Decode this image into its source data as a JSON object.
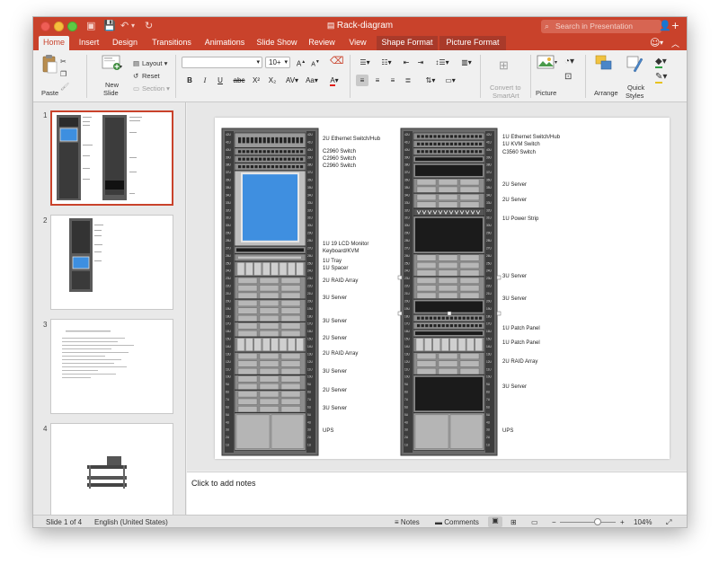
{
  "window": {
    "doc_title": "Rack-diagram",
    "search_placeholder": "Search in Presentation"
  },
  "tabs": [
    {
      "label": "Home",
      "active": true
    },
    {
      "label": "Insert"
    },
    {
      "label": "Design"
    },
    {
      "label": "Transitions"
    },
    {
      "label": "Animations"
    },
    {
      "label": "Slide Show"
    },
    {
      "label": "Review"
    },
    {
      "label": "View"
    },
    {
      "label": "Shape Format",
      "contextual": true
    },
    {
      "label": "Picture Format",
      "contextual": true
    }
  ],
  "ribbon": {
    "paste": "Paste",
    "new_slide_line1": "New",
    "new_slide_line2": "Slide",
    "layout": "Layout",
    "reset": "Reset",
    "section": "Section",
    "font_name": "",
    "font_size": "10+",
    "bold": "B",
    "italic": "I",
    "underline": "U",
    "strike": "abc",
    "superscript": "X²",
    "subscript": "X₂",
    "convert_line1": "Convert to",
    "convert_line2": "SmartArt",
    "picture": "Picture",
    "arrange": "Arrange",
    "quick_styles_line1": "Quick",
    "quick_styles_line2": "Styles"
  },
  "thumbnails": [
    {
      "num": "1",
      "selected": true
    },
    {
      "num": "2"
    },
    {
      "num": "3"
    },
    {
      "num": "4"
    }
  ],
  "notes_placeholder": "Click to add notes",
  "status": {
    "slide_count": "Slide 1 of 4",
    "language": "English (United States)",
    "notes": "Notes",
    "comments": "Comments",
    "zoom": "104%",
    "zoom_level": 0.68
  },
  "racks": {
    "left": {
      "labels": [
        "2U Ethernet Switch/Hub",
        "C2960 Switch",
        "C2960 Switch",
        "C2960 Switch",
        "1U 19 LCD Monitor",
        "Keyboard/KVM",
        "1U Tray",
        "1U Spacer",
        "2U RAID Array",
        "3U Server",
        "3U Server",
        "2U Server",
        "2U RAID Array",
        "3U Server",
        "2U Server",
        "3U Server",
        "UPS"
      ],
      "units": [
        "42U",
        "41U",
        "40U",
        "39U",
        "38U",
        "37U",
        "36U",
        "35U",
        "34U",
        "33U",
        "32U",
        "31U",
        "30U",
        "29U",
        "28U",
        "27U",
        "26U",
        "25U",
        "24U",
        "23U",
        "22U",
        "21U",
        "20U",
        "19U",
        "18U",
        "17U",
        "16U",
        "15U",
        "14U",
        "13U",
        "12U",
        "11U",
        "10U",
        "9U",
        "8U",
        "7U",
        "6U",
        "5U",
        "4U",
        "3U",
        "2U",
        "1U"
      ]
    },
    "right": {
      "labels": [
        "1U Ethernet Switch/Hub",
        "1U KVM Switch",
        "C3560 Switch",
        "2U Server",
        "2U Server",
        "1U Power Strip",
        "3U Server",
        "3U Server",
        "1U Patch Panel",
        "1U Patch Panel",
        "2U RAID Array",
        "3U Server",
        "UPS"
      ],
      "units": [
        "42U",
        "41U",
        "40U",
        "39U",
        "38U",
        "37U",
        "36U",
        "35U",
        "34U",
        "33U",
        "32U",
        "31U",
        "30U",
        "29U",
        "28U",
        "27U",
        "26U",
        "25U",
        "24U",
        "23U",
        "22U",
        "21U",
        "20U",
        "19U",
        "18U",
        "17U",
        "16U",
        "15U",
        "14U",
        "13U",
        "12U",
        "11U",
        "10U",
        "9U",
        "8U",
        "7U",
        "6U",
        "5U",
        "4U",
        "3U",
        "2U",
        "1U"
      ]
    }
  },
  "slide3_heading": "...",
  "colors": {
    "accent": "#c9422b",
    "contextual_tab": "#a93a2a"
  }
}
